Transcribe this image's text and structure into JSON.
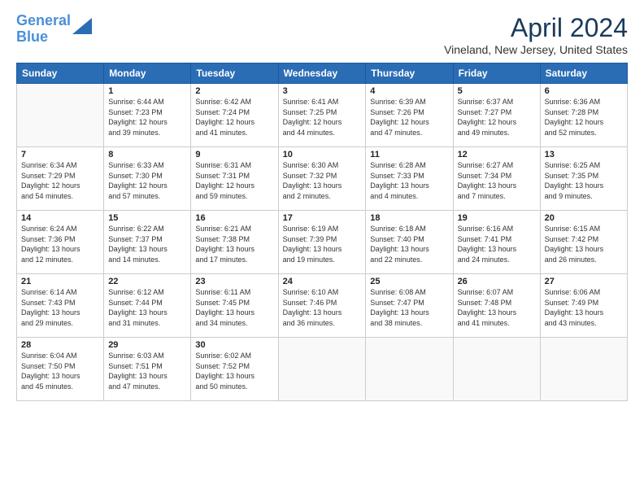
{
  "header": {
    "logo_line1": "General",
    "logo_line2": "Blue",
    "title": "April 2024",
    "subtitle": "Vineland, New Jersey, United States"
  },
  "days_of_week": [
    "Sunday",
    "Monday",
    "Tuesday",
    "Wednesday",
    "Thursday",
    "Friday",
    "Saturday"
  ],
  "weeks": [
    [
      {
        "day": "",
        "info": ""
      },
      {
        "day": "1",
        "info": "Sunrise: 6:44 AM\nSunset: 7:23 PM\nDaylight: 12 hours\nand 39 minutes."
      },
      {
        "day": "2",
        "info": "Sunrise: 6:42 AM\nSunset: 7:24 PM\nDaylight: 12 hours\nand 41 minutes."
      },
      {
        "day": "3",
        "info": "Sunrise: 6:41 AM\nSunset: 7:25 PM\nDaylight: 12 hours\nand 44 minutes."
      },
      {
        "day": "4",
        "info": "Sunrise: 6:39 AM\nSunset: 7:26 PM\nDaylight: 12 hours\nand 47 minutes."
      },
      {
        "day": "5",
        "info": "Sunrise: 6:37 AM\nSunset: 7:27 PM\nDaylight: 12 hours\nand 49 minutes."
      },
      {
        "day": "6",
        "info": "Sunrise: 6:36 AM\nSunset: 7:28 PM\nDaylight: 12 hours\nand 52 minutes."
      }
    ],
    [
      {
        "day": "7",
        "info": "Sunrise: 6:34 AM\nSunset: 7:29 PM\nDaylight: 12 hours\nand 54 minutes."
      },
      {
        "day": "8",
        "info": "Sunrise: 6:33 AM\nSunset: 7:30 PM\nDaylight: 12 hours\nand 57 minutes."
      },
      {
        "day": "9",
        "info": "Sunrise: 6:31 AM\nSunset: 7:31 PM\nDaylight: 12 hours\nand 59 minutes."
      },
      {
        "day": "10",
        "info": "Sunrise: 6:30 AM\nSunset: 7:32 PM\nDaylight: 13 hours\nand 2 minutes."
      },
      {
        "day": "11",
        "info": "Sunrise: 6:28 AM\nSunset: 7:33 PM\nDaylight: 13 hours\nand 4 minutes."
      },
      {
        "day": "12",
        "info": "Sunrise: 6:27 AM\nSunset: 7:34 PM\nDaylight: 13 hours\nand 7 minutes."
      },
      {
        "day": "13",
        "info": "Sunrise: 6:25 AM\nSunset: 7:35 PM\nDaylight: 13 hours\nand 9 minutes."
      }
    ],
    [
      {
        "day": "14",
        "info": "Sunrise: 6:24 AM\nSunset: 7:36 PM\nDaylight: 13 hours\nand 12 minutes."
      },
      {
        "day": "15",
        "info": "Sunrise: 6:22 AM\nSunset: 7:37 PM\nDaylight: 13 hours\nand 14 minutes."
      },
      {
        "day": "16",
        "info": "Sunrise: 6:21 AM\nSunset: 7:38 PM\nDaylight: 13 hours\nand 17 minutes."
      },
      {
        "day": "17",
        "info": "Sunrise: 6:19 AM\nSunset: 7:39 PM\nDaylight: 13 hours\nand 19 minutes."
      },
      {
        "day": "18",
        "info": "Sunrise: 6:18 AM\nSunset: 7:40 PM\nDaylight: 13 hours\nand 22 minutes."
      },
      {
        "day": "19",
        "info": "Sunrise: 6:16 AM\nSunset: 7:41 PM\nDaylight: 13 hours\nand 24 minutes."
      },
      {
        "day": "20",
        "info": "Sunrise: 6:15 AM\nSunset: 7:42 PM\nDaylight: 13 hours\nand 26 minutes."
      }
    ],
    [
      {
        "day": "21",
        "info": "Sunrise: 6:14 AM\nSunset: 7:43 PM\nDaylight: 13 hours\nand 29 minutes."
      },
      {
        "day": "22",
        "info": "Sunrise: 6:12 AM\nSunset: 7:44 PM\nDaylight: 13 hours\nand 31 minutes."
      },
      {
        "day": "23",
        "info": "Sunrise: 6:11 AM\nSunset: 7:45 PM\nDaylight: 13 hours\nand 34 minutes."
      },
      {
        "day": "24",
        "info": "Sunrise: 6:10 AM\nSunset: 7:46 PM\nDaylight: 13 hours\nand 36 minutes."
      },
      {
        "day": "25",
        "info": "Sunrise: 6:08 AM\nSunset: 7:47 PM\nDaylight: 13 hours\nand 38 minutes."
      },
      {
        "day": "26",
        "info": "Sunrise: 6:07 AM\nSunset: 7:48 PM\nDaylight: 13 hours\nand 41 minutes."
      },
      {
        "day": "27",
        "info": "Sunrise: 6:06 AM\nSunset: 7:49 PM\nDaylight: 13 hours\nand 43 minutes."
      }
    ],
    [
      {
        "day": "28",
        "info": "Sunrise: 6:04 AM\nSunset: 7:50 PM\nDaylight: 13 hours\nand 45 minutes."
      },
      {
        "day": "29",
        "info": "Sunrise: 6:03 AM\nSunset: 7:51 PM\nDaylight: 13 hours\nand 47 minutes."
      },
      {
        "day": "30",
        "info": "Sunrise: 6:02 AM\nSunset: 7:52 PM\nDaylight: 13 hours\nand 50 minutes."
      },
      {
        "day": "",
        "info": ""
      },
      {
        "day": "",
        "info": ""
      },
      {
        "day": "",
        "info": ""
      },
      {
        "day": "",
        "info": ""
      }
    ]
  ]
}
